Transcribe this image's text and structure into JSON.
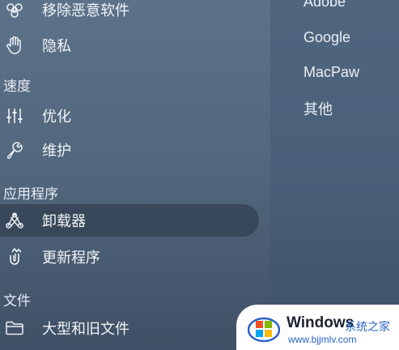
{
  "sidebar": {
    "items": [
      {
        "label": "移除恶意软件",
        "icon": "biohazard-icon"
      },
      {
        "label": "隐私",
        "icon": "hand-icon"
      },
      {
        "label": "优化",
        "icon": "sliders-icon"
      },
      {
        "label": "维护",
        "icon": "wrench-icon"
      },
      {
        "label": "卸载器",
        "icon": "apps-icon",
        "selected": true
      },
      {
        "label": "更新程序",
        "icon": "update-icon"
      },
      {
        "label": "大型和旧文件",
        "icon": "folder-icon"
      }
    ],
    "sections": {
      "speed": "速度",
      "apps": "应用程序",
      "files": "文件"
    }
  },
  "vendors": [
    "Adobe",
    "Google",
    "MacPaw",
    "其他"
  ],
  "watermark": {
    "title": "Windows",
    "subtitle": "系统之家",
    "url": "www.bjjmlv.com"
  },
  "colors": {
    "selected_bg": "#2c3a4c",
    "text": "#f1f4f8",
    "watermark_blue": "#2b63c6"
  }
}
